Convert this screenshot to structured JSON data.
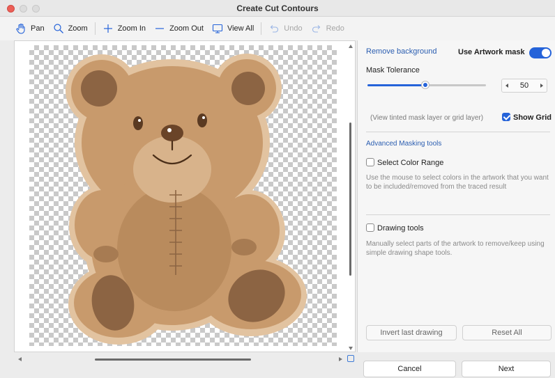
{
  "window": {
    "title": "Create Cut Contours"
  },
  "toolbar": {
    "pan": "Pan",
    "zoom": "Zoom",
    "zoom_in": "Zoom In",
    "zoom_out": "Zoom Out",
    "view_all": "View All",
    "undo": "Undo",
    "redo": "Redo"
  },
  "panel": {
    "remove_background": "Remove background",
    "use_artwork_mask": "Use Artwork mask",
    "use_artwork_mask_on": true,
    "mask_tolerance_label": "Mask Tolerance",
    "mask_tolerance_value": "50",
    "mask_tolerance_fraction": 0.5,
    "view_hint": "(View tinted mask layer or grid layer)",
    "show_grid": "Show Grid",
    "show_grid_checked": true,
    "advanced_tools": "Advanced Masking tools",
    "select_color_range": "Select Color Range",
    "select_color_range_desc": "Use the mouse to select colors in the artwork that you want to be included/removed from the traced result",
    "drawing_tools": "Drawing tools",
    "drawing_tools_desc": "Manually select parts of the artwork to remove/keep using simple drawing shape tools.",
    "invert_last_drawing": "Invert last drawing",
    "reset_all": "Reset All"
  },
  "footer": {
    "cancel": "Cancel",
    "next": "Next"
  },
  "colors": {
    "accent": "#2563d9",
    "link": "#2a5db0",
    "close": "#ec5f57"
  }
}
